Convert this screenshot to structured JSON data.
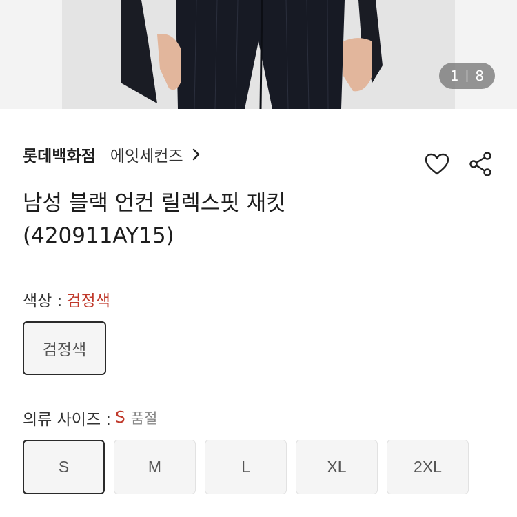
{
  "gallery": {
    "current": "1",
    "separator": "|",
    "total": "8"
  },
  "brand": {
    "store": "롯데백화점",
    "name": "에잇세컨즈"
  },
  "product": {
    "title_line1": "남성 블랙 언컨 릴렉스핏 재킷",
    "title_line2": "(420911AY15)"
  },
  "color_option": {
    "label": "색상 :",
    "selected": "검정색",
    "options": [
      "검정색"
    ]
  },
  "size_option": {
    "label": "의류 사이즈 :",
    "selected": "S",
    "status": "품절",
    "options": [
      "S",
      "M",
      "L",
      "XL",
      "2XL"
    ]
  },
  "colors": {
    "accent": "#c0392b",
    "selected_border": "#2a2a2a",
    "indicator_bg": "#6e6e6e"
  },
  "icons": {
    "wishlist": "heart-icon",
    "share": "share-icon",
    "brand_link": "chevron-right-icon"
  }
}
